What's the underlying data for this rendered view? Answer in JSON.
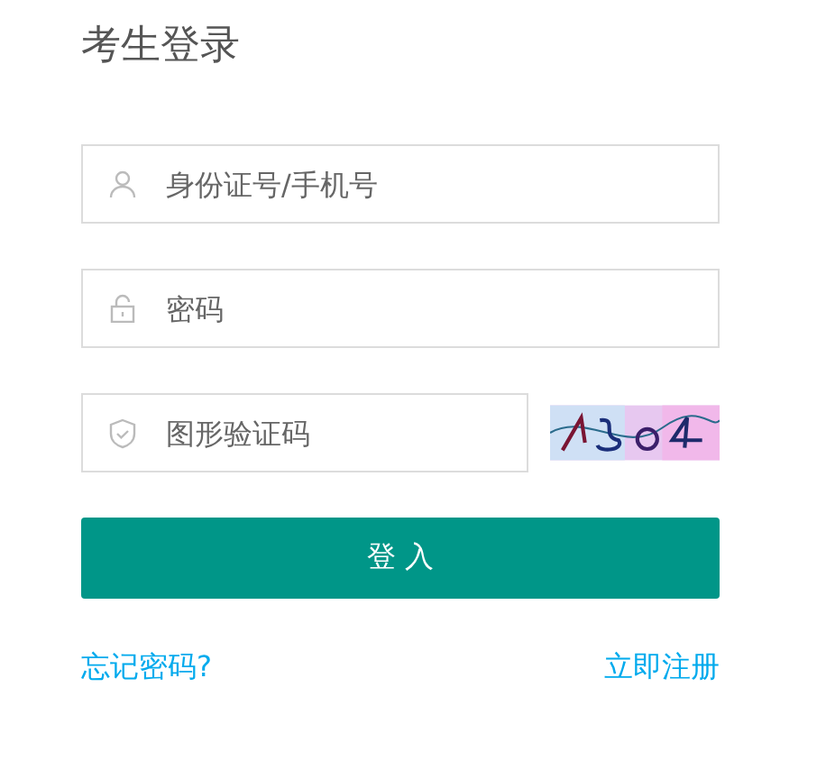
{
  "title": "考生登录",
  "fields": [
    {
      "kind": "user",
      "placeholder": "身份证号/手机号"
    },
    {
      "kind": "lock",
      "placeholder": "密码"
    }
  ],
  "captcha": {
    "placeholder": "图形验证码"
  },
  "submit": "登 入",
  "links": [
    {
      "label": "忘记密码?"
    },
    {
      "label": "立即注册"
    }
  ]
}
